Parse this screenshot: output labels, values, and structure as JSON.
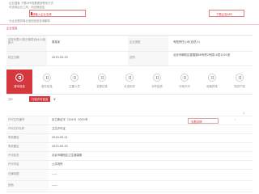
{
  "notice": {
    "line1": "·企业搜索  下载APP查看更多联系方式",
    "line2": "·可查询企业工商、司法等信息",
    "search_placeholder": "请输入企业名称",
    "search_button": "下载企查APP",
    "line3": "·为企业提供商业信用信息查询服务"
  },
  "section_title": "企业信息",
  "info_rows": [
    {
      "label": "法定代表人/执行事务合伙人/负责人",
      "value": "周某某",
      "label2": "企业类型",
      "value2": "有限责任公司(自然人)"
    },
    {
      "label": "成立日期",
      "value": "2019-03-19",
      "label2": "住所",
      "value2": "北京市朝阳区建国路88号院2号楼10层1001室"
    }
  ],
  "tabs": [
    {
      "label": "基本信息",
      "active": true
    },
    {
      "label": "股东信息",
      "active": false
    },
    {
      "label": "主要人员",
      "active": false
    },
    {
      "label": "变更记录",
      "active": false
    },
    {
      "label": "分支机构",
      "active": false
    },
    {
      "label": "对外投资",
      "active": false
    },
    {
      "label": "行政许可",
      "active": false
    },
    {
      "label": "经营异常",
      "active": false
    },
    {
      "label": "知识产权",
      "active": false
    }
  ],
  "filter": {
    "count": "共6",
    "chip": "行政许可信息",
    "more": "▼"
  },
  "page_number": "1",
  "detail": {
    "title": "",
    "link_label": "查看详情",
    "arrow": "›",
    "rows": [
      {
        "label": "许可文件编号",
        "value": "京卫食证字〔2019〕0001号"
      },
      {
        "label": "许可文件名称",
        "value": "卫生许可证"
      },
      {
        "label": "有效期自",
        "value": "2019-05-21"
      },
      {
        "label": "有效期至",
        "value": "2023-05-20"
      },
      {
        "label": "许可机关",
        "value": "北京市朝阳区卫生健康委"
      },
      {
        "label": "许可内容",
        "value": "公共场所"
      },
      {
        "label": "法律依据",
        "value": "——"
      },
      {
        "label": "其他",
        "value": "——"
      }
    ]
  }
}
